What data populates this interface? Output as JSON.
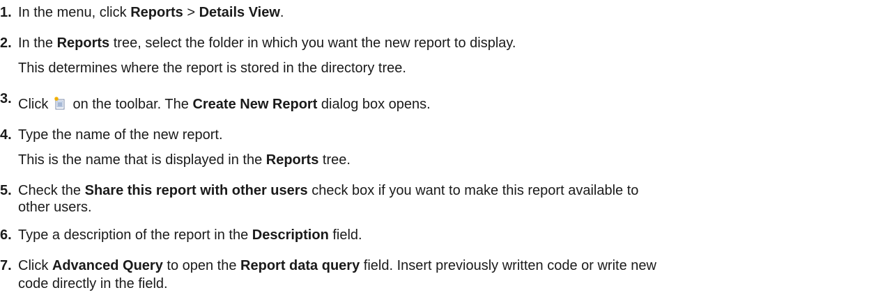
{
  "steps": [
    {
      "num": "1.",
      "parts": [
        "In the menu, click ",
        "Reports",
        " > ",
        "Details View",
        "."
      ]
    },
    {
      "num": "2.",
      "parts": [
        "In the ",
        "Reports",
        " tree, select the folder in which you want the new report to display."
      ],
      "note": "This determines where the report is stored in the directory tree."
    },
    {
      "num": "3.",
      "parts": [
        "Click ",
        " on the toolbar. The ",
        "Create New Report",
        " dialog box opens."
      ],
      "icon": "new-report-icon"
    },
    {
      "num": "4.",
      "parts": [
        "Type the name of the new report."
      ],
      "note_parts": [
        "This is the name that is displayed in the ",
        "Reports",
        " tree."
      ]
    },
    {
      "num": "5.",
      "parts": [
        "Check the ",
        "Share this report with other users",
        " check box if you want to make this report available to"
      ],
      "cont": "other users."
    },
    {
      "num": "6.",
      "parts": [
        "Type a description of the report in the ",
        "Description",
        " field."
      ]
    },
    {
      "num": "7.",
      "parts": [
        "Click ",
        "Advanced Query",
        " to open the ",
        "Report data query",
        " field. Insert previously written code or write new"
      ],
      "cont": "code directly in the field."
    }
  ]
}
